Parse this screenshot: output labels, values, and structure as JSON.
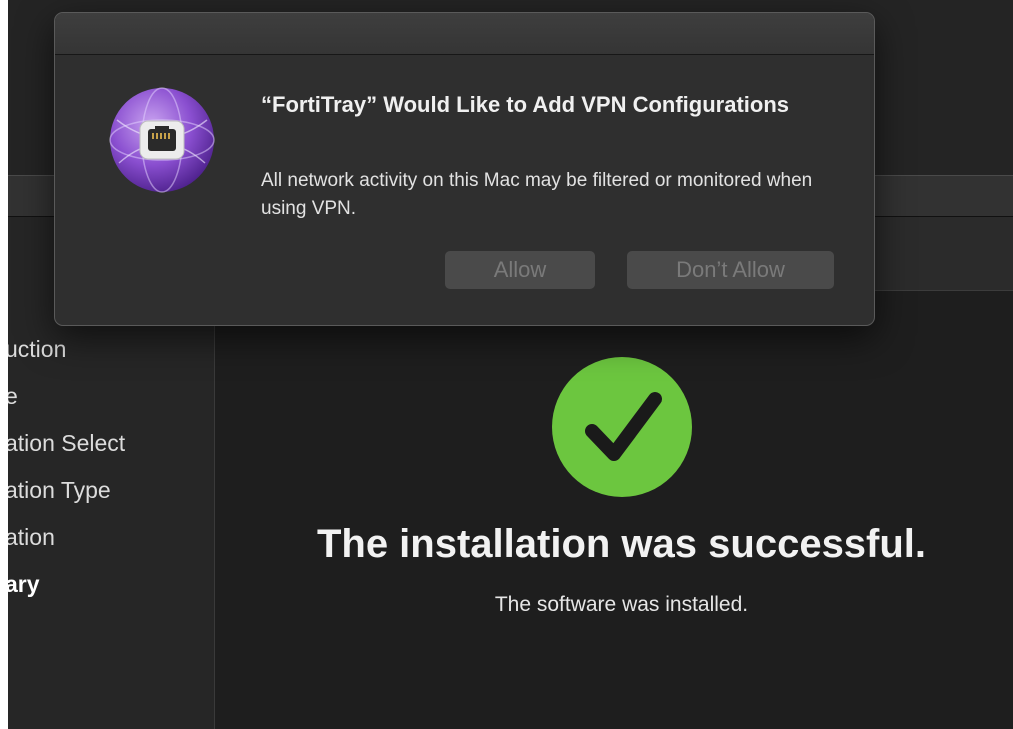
{
  "dialog": {
    "title": "“FortiTray” Would Like to Add VPN Configurations",
    "message": "All network activity on this Mac may be filtered or monitored when using VPN.",
    "allow_label": "Allow",
    "dont_allow_label": "Don’t Allow",
    "app_icon": "fortitray-ethernet-icon"
  },
  "sidebar": {
    "items": [
      {
        "label": "uction"
      },
      {
        "label": "e"
      },
      {
        "label": "ation Select"
      },
      {
        "label": "ation Type"
      },
      {
        "label": "ation"
      },
      {
        "label": "ary"
      }
    ]
  },
  "main": {
    "success_icon": "checkmark-icon",
    "success_title": "The installation was successful.",
    "success_subtitle": "The software was installed."
  },
  "colors": {
    "success_green": "#6cc63f",
    "dialog_bg": "#2f2f2f",
    "window_bg": "#1e1e1e"
  }
}
